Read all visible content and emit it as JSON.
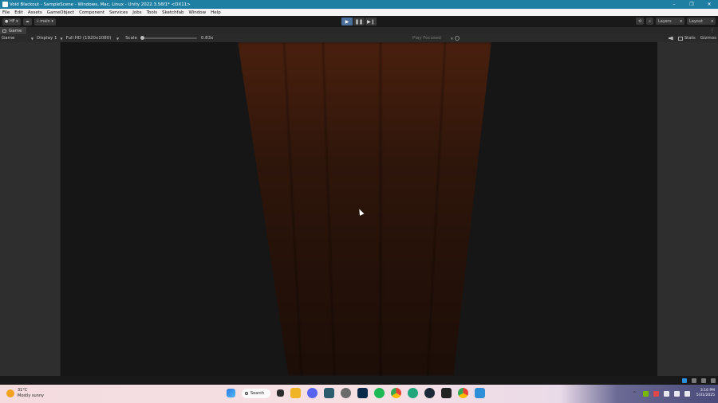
{
  "window": {
    "title": "Void Blackout - SampleScene - Windows, Mac, Linux - Unity 2022.3.56f1* <DX11>",
    "minimize": "–",
    "maximize": "❐",
    "close": "✕"
  },
  "menu": [
    "File",
    "Edit",
    "Assets",
    "GameObject",
    "Component",
    "Services",
    "Jobs",
    "Tools",
    "Sketchfab",
    "Window",
    "Help"
  ],
  "toolbar": {
    "account": "HF",
    "branch": "main",
    "play": "▶",
    "pause": "❚❚",
    "step": "▶❙",
    "layers": "Layers",
    "layout": "Layout"
  },
  "game_tab": {
    "label": "Game",
    "menu": "⋮"
  },
  "game_bar": {
    "view_mode": "Game",
    "display": "Display 1",
    "resolution": "Full HD (1920x1080)",
    "scale_label": "Scale",
    "scale_value": "0.83x",
    "play_focused": "Play Focused",
    "stats": "Stats",
    "gizmos": "Gizmos"
  },
  "taskbar": {
    "temperature": "31°C",
    "condition": "Mostly sunny",
    "search": "Search",
    "time": "3:16 PM",
    "date": "5/31/2025"
  },
  "colors": {
    "title_bar": "#1f7fa3",
    "play_active": "#4b6f9c",
    "curtain": "#3a1a0c"
  }
}
